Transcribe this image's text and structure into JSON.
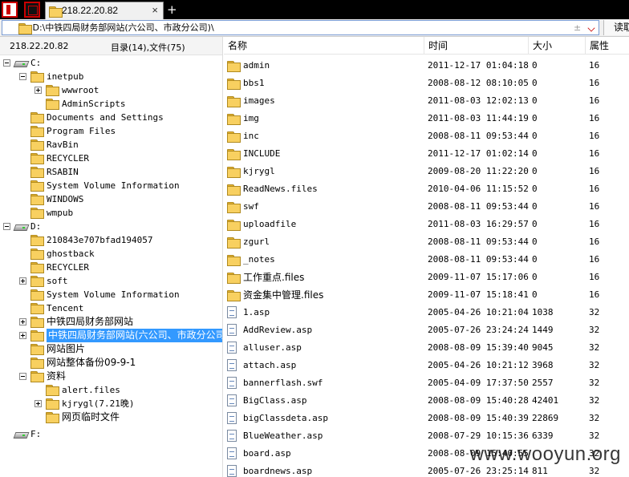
{
  "tab": {
    "title": "218.22.20.82",
    "close": "×",
    "add": "+"
  },
  "address": {
    "path": "D:\\中铁四局财务部网站(六公司、市政分公司)\\",
    "plus": "±",
    "read_label": "读取"
  },
  "left": {
    "host": "218.22.20.82",
    "count": "目录(14),文件(75)",
    "tree": [
      {
        "label": "C:",
        "type": "drive",
        "expander": "minus",
        "indent": 0
      },
      {
        "label": "inetpub",
        "type": "folder",
        "expander": "minus",
        "indent": 1
      },
      {
        "label": "wwwroot",
        "type": "folder",
        "expander": "plus",
        "indent": 2
      },
      {
        "label": "AdminScripts",
        "type": "folder",
        "expander": "",
        "indent": 2
      },
      {
        "label": "Documents and Settings",
        "type": "folder",
        "expander": "",
        "indent": 1
      },
      {
        "label": "Program Files",
        "type": "folder",
        "expander": "",
        "indent": 1
      },
      {
        "label": "RavBin",
        "type": "folder",
        "expander": "",
        "indent": 1
      },
      {
        "label": "RECYCLER",
        "type": "folder",
        "expander": "",
        "indent": 1
      },
      {
        "label": "RSABIN",
        "type": "folder",
        "expander": "",
        "indent": 1
      },
      {
        "label": "System Volume Information",
        "type": "folder",
        "expander": "",
        "indent": 1
      },
      {
        "label": "WINDOWS",
        "type": "folder",
        "expander": "",
        "indent": 1
      },
      {
        "label": "wmpub",
        "type": "folder",
        "expander": "",
        "indent": 1
      },
      {
        "label": "D:",
        "type": "drive",
        "expander": "minus",
        "indent": 0
      },
      {
        "label": "210843e707bfad194057",
        "type": "folder",
        "expander": "",
        "indent": 1
      },
      {
        "label": "ghostback",
        "type": "folder",
        "expander": "",
        "indent": 1
      },
      {
        "label": "RECYCLER",
        "type": "folder",
        "expander": "",
        "indent": 1
      },
      {
        "label": "soft",
        "type": "folder",
        "expander": "plus",
        "indent": 1
      },
      {
        "label": "System Volume Information",
        "type": "folder",
        "expander": "",
        "indent": 1
      },
      {
        "label": "Tencent",
        "type": "folder",
        "expander": "",
        "indent": 1
      },
      {
        "label": "中铁四局财务部网站",
        "type": "folder",
        "expander": "plus",
        "indent": 1,
        "cjk": true
      },
      {
        "label": "中铁四局财务部网站(六公司、市政分公司)",
        "type": "folder",
        "expander": "plus",
        "indent": 1,
        "cjk": true,
        "selected": true
      },
      {
        "label": "网站图片",
        "type": "folder",
        "expander": "",
        "indent": 1,
        "cjk": true
      },
      {
        "label": "网站整体备份09-9-1",
        "type": "folder",
        "expander": "",
        "indent": 1,
        "cjk": true
      },
      {
        "label": "资料",
        "type": "folder",
        "expander": "minus",
        "indent": 1,
        "cjk": true
      },
      {
        "label": "alert.files",
        "type": "folder",
        "expander": "",
        "indent": 2
      },
      {
        "label": "kjrygl(7.21晚)",
        "type": "folder",
        "expander": "plus",
        "indent": 2
      },
      {
        "label": "网页临时文件",
        "type": "folder",
        "expander": "",
        "indent": 2,
        "cjk": true
      },
      {
        "label": "F:",
        "type": "drive",
        "expander": "",
        "indent": 0,
        "gap": true
      }
    ]
  },
  "list": {
    "headers": {
      "name": "名称",
      "time": "时间",
      "size": "大小",
      "attr": "属性"
    },
    "rows": [
      {
        "name": "admin",
        "time": "2011-12-17 01:04:18",
        "size": "0",
        "attr": "16",
        "type": "folder"
      },
      {
        "name": "bbs1",
        "time": "2008-08-12 08:10:05",
        "size": "0",
        "attr": "16",
        "type": "folder"
      },
      {
        "name": "images",
        "time": "2011-08-03 12:02:13",
        "size": "0",
        "attr": "16",
        "type": "folder"
      },
      {
        "name": "img",
        "time": "2011-08-03 11:44:19",
        "size": "0",
        "attr": "16",
        "type": "folder"
      },
      {
        "name": "inc",
        "time": "2008-08-11 09:53:44",
        "size": "0",
        "attr": "16",
        "type": "folder"
      },
      {
        "name": "INCLUDE",
        "time": "2011-12-17 01:02:14",
        "size": "0",
        "attr": "16",
        "type": "folder"
      },
      {
        "name": "kjrygl",
        "time": "2009-08-20 11:22:20",
        "size": "0",
        "attr": "16",
        "type": "folder"
      },
      {
        "name": "ReadNews.files",
        "time": "2010-04-06 11:15:52",
        "size": "0",
        "attr": "16",
        "type": "folder"
      },
      {
        "name": "swf",
        "time": "2008-08-11 09:53:44",
        "size": "0",
        "attr": "16",
        "type": "folder"
      },
      {
        "name": "uploadfile",
        "time": "2011-08-03 16:29:57",
        "size": "0",
        "attr": "16",
        "type": "folder"
      },
      {
        "name": "zgurl",
        "time": "2008-08-11 09:53:44",
        "size": "0",
        "attr": "16",
        "type": "folder"
      },
      {
        "name": "_notes",
        "time": "2008-08-11 09:53:44",
        "size": "0",
        "attr": "16",
        "type": "folder"
      },
      {
        "name": "工作重点.files",
        "time": "2009-11-07 15:17:06",
        "size": "0",
        "attr": "16",
        "type": "folder",
        "cjk": true
      },
      {
        "name": "资金集中管理.files",
        "time": "2009-11-07 15:18:41",
        "size": "0",
        "attr": "16",
        "type": "folder",
        "cjk": true
      },
      {
        "name": "1.asp",
        "time": "2005-04-26 10:21:04",
        "size": "1038",
        "attr": "32",
        "type": "file"
      },
      {
        "name": "AddReview.asp",
        "time": "2005-07-26 23:24:24",
        "size": "1449",
        "attr": "32",
        "type": "file"
      },
      {
        "name": "alluser.asp",
        "time": "2008-08-09 15:39:40",
        "size": "9045",
        "attr": "32",
        "type": "file"
      },
      {
        "name": "attach.asp",
        "time": "2005-04-26 10:21:12",
        "size": "3968",
        "attr": "32",
        "type": "file"
      },
      {
        "name": "bannerflash.swf",
        "time": "2005-04-09 17:37:50",
        "size": "2557",
        "attr": "32",
        "type": "file"
      },
      {
        "name": "BigClass.asp",
        "time": "2008-08-09 15:40:28",
        "size": "42401",
        "attr": "32",
        "type": "file"
      },
      {
        "name": "bigClassdeta.asp",
        "time": "2008-08-09 15:40:39",
        "size": "22869",
        "attr": "32",
        "type": "file"
      },
      {
        "name": "BlueWeather.asp",
        "time": "2008-07-29 10:15:36",
        "size": "6339",
        "attr": "32",
        "type": "file"
      },
      {
        "name": "board.asp",
        "time": "2008-08-09 15:40:55",
        "size": "",
        "attr": "32",
        "type": "file"
      },
      {
        "name": "boardnews.asp",
        "time": "2005-07-26 23:25:14",
        "size": "811",
        "attr": "32",
        "type": "file"
      }
    ]
  },
  "watermark": "www.wooyun.org"
}
